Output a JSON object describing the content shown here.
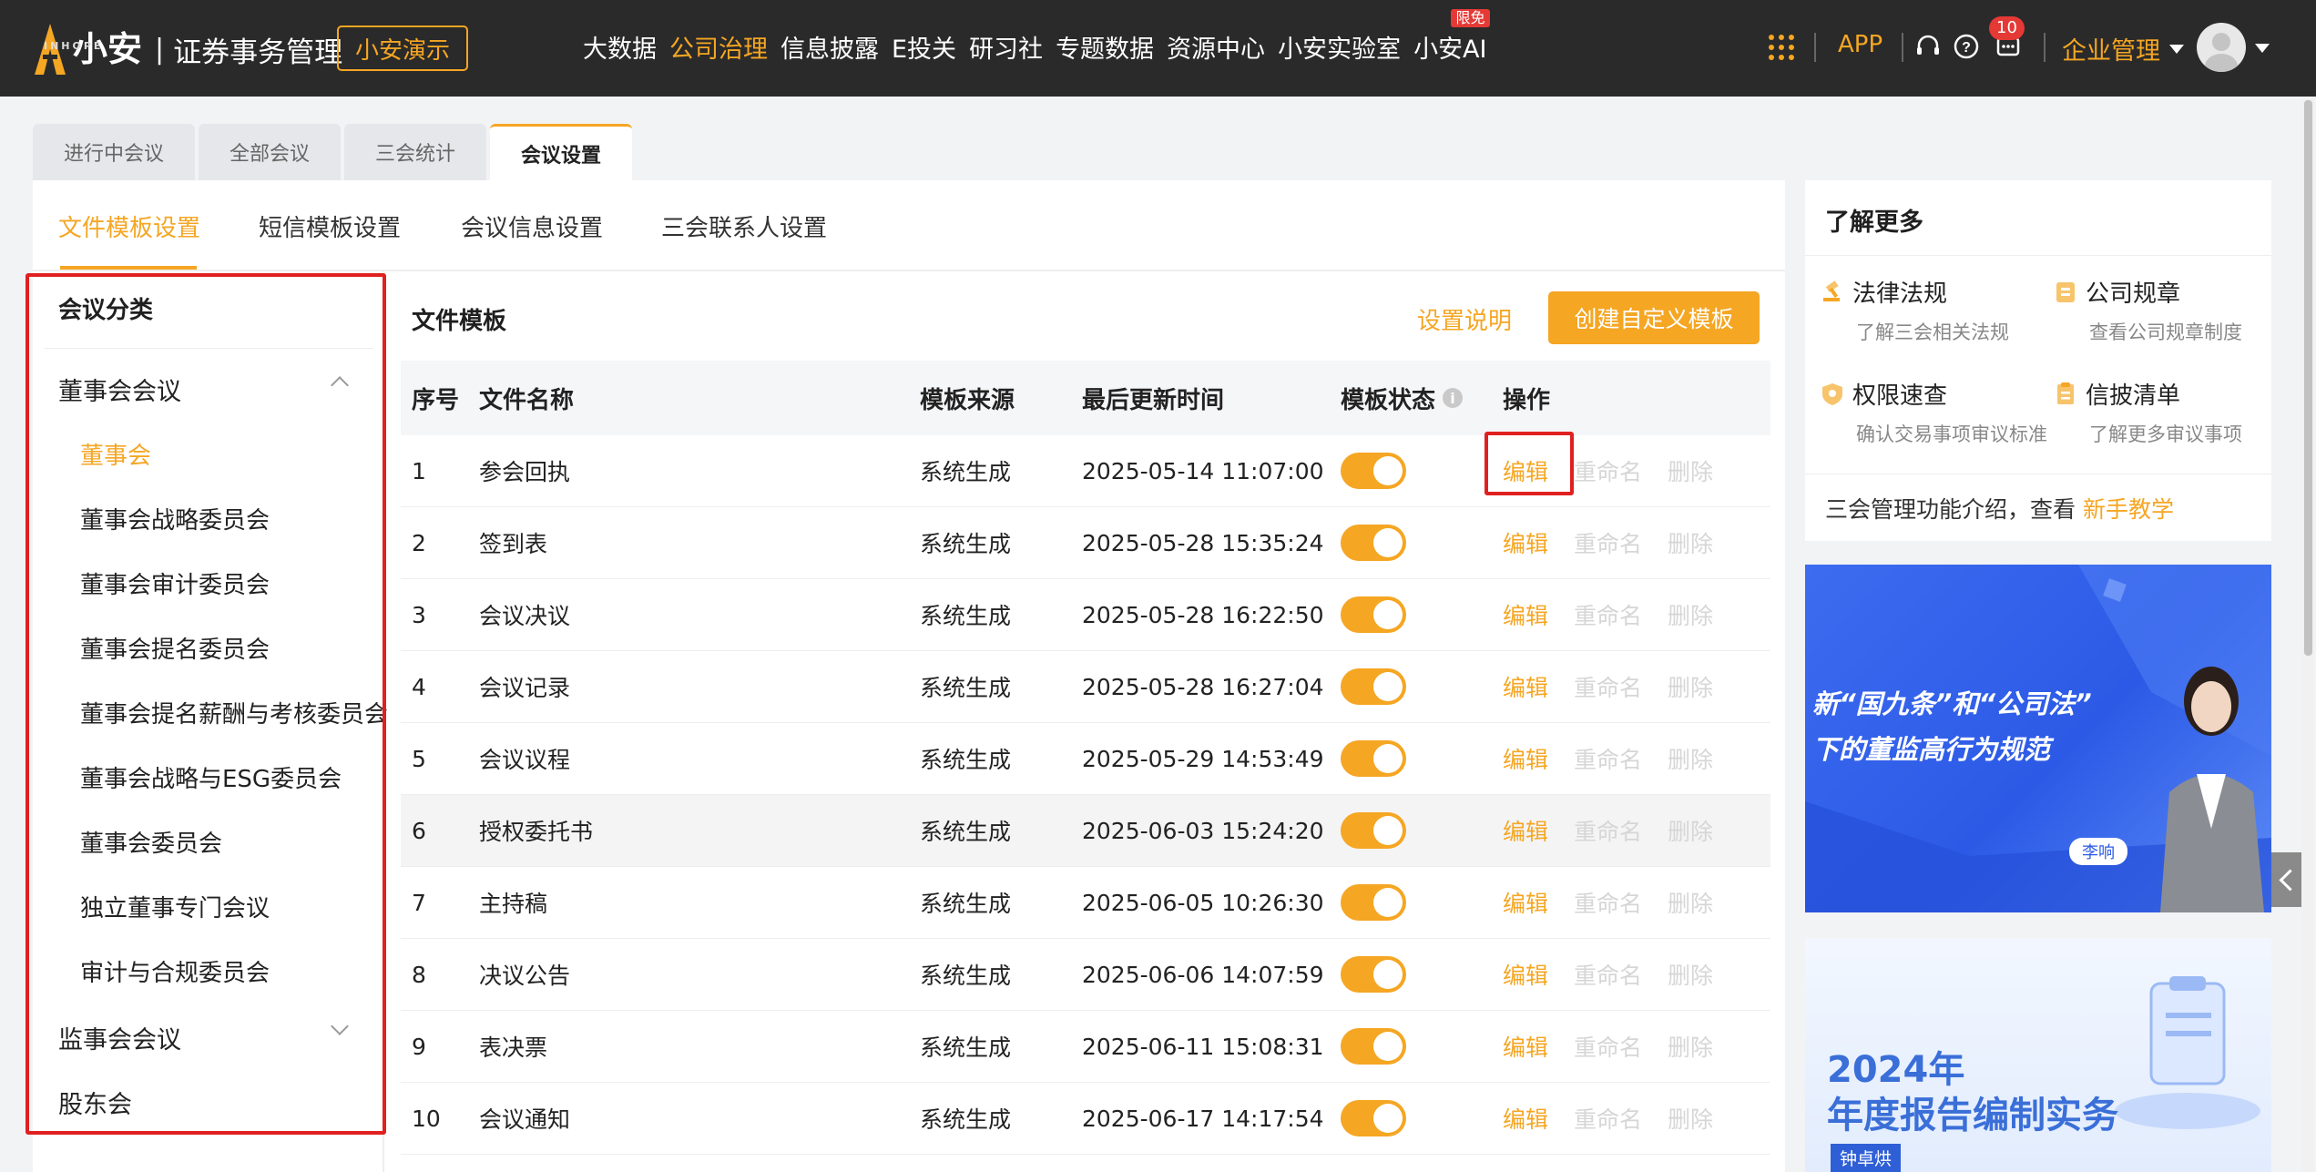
{
  "brand": {
    "name": "小安",
    "sub": "INHOPE",
    "separator": "|",
    "title": "证券事务管理",
    "demo_button": "小安演示"
  },
  "nav": [
    {
      "label": "大数据",
      "active": false
    },
    {
      "label": "公司治理",
      "active": true
    },
    {
      "label": "信息披露",
      "active": false
    },
    {
      "label": "E投关",
      "active": false
    },
    {
      "label": "研习社",
      "active": false
    },
    {
      "label": "专题数据",
      "active": false
    },
    {
      "label": "资源中心",
      "active": false
    },
    {
      "label": "小安实验室",
      "active": false
    },
    {
      "label": "小安AI",
      "active": false,
      "badge": "限免"
    }
  ],
  "topright": {
    "app": "APP",
    "message_count": "10",
    "company_menu": "企业管理",
    "icons": [
      "apps-grid-icon",
      "headset-icon",
      "help-icon",
      "message-icon",
      "avatar"
    ]
  },
  "page_tabs": [
    {
      "label": "进行中会议",
      "active": false
    },
    {
      "label": "全部会议",
      "active": false
    },
    {
      "label": "三会统计",
      "active": false
    },
    {
      "label": "会议设置",
      "active": true
    }
  ],
  "sub_tabs": [
    {
      "label": "文件模板设置",
      "active": true
    },
    {
      "label": "短信模板设置",
      "active": false
    },
    {
      "label": "会议信息设置",
      "active": false
    },
    {
      "label": "三会联系人设置",
      "active": false
    }
  ],
  "categories": {
    "title": "会议分类",
    "groups": [
      {
        "label": "董事会会议",
        "expanded": true,
        "items": [
          {
            "label": "董事会",
            "active": true
          },
          {
            "label": "董事会战略委员会",
            "active": false
          },
          {
            "label": "董事会审计委员会",
            "active": false
          },
          {
            "label": "董事会提名委员会",
            "active": false
          },
          {
            "label": "董事会提名薪酬与考核委员会",
            "active": false
          },
          {
            "label": "董事会战略与ESG委员会",
            "active": false
          },
          {
            "label": "董事会委员会",
            "active": false
          },
          {
            "label": "独立董事专门会议",
            "active": false
          },
          {
            "label": "审计与合规委员会",
            "active": false
          }
        ]
      },
      {
        "label": "监事会会议",
        "expanded": false,
        "items": []
      },
      {
        "label": "股东会",
        "expanded": false,
        "items": []
      }
    ]
  },
  "templates": {
    "title": "文件模板",
    "help_link": "设置说明",
    "create_button": "创建自定义模板",
    "columns": [
      "序号",
      "文件名称",
      "模板来源",
      "最后更新时间",
      "模板状态",
      "操作"
    ],
    "ops": [
      "编辑",
      "重命名",
      "删除"
    ],
    "rows": [
      {
        "idx": "1",
        "name": "参会回执",
        "source": "系统生成",
        "updated": "2025-05-14 11:07:00",
        "enabled": true
      },
      {
        "idx": "2",
        "name": "签到表",
        "source": "系统生成",
        "updated": "2025-05-28 15:35:24",
        "enabled": true
      },
      {
        "idx": "3",
        "name": "会议决议",
        "source": "系统生成",
        "updated": "2025-05-28 16:22:50",
        "enabled": true
      },
      {
        "idx": "4",
        "name": "会议记录",
        "source": "系统生成",
        "updated": "2025-05-28 16:27:04",
        "enabled": true
      },
      {
        "idx": "5",
        "name": "会议议程",
        "source": "系统生成",
        "updated": "2025-05-29 14:53:49",
        "enabled": true
      },
      {
        "idx": "6",
        "name": "授权委托书",
        "source": "系统生成",
        "updated": "2025-06-03 15:24:20",
        "enabled": true
      },
      {
        "idx": "7",
        "name": "主持稿",
        "source": "系统生成",
        "updated": "2025-06-05 10:26:30",
        "enabled": true
      },
      {
        "idx": "8",
        "name": "决议公告",
        "source": "系统生成",
        "updated": "2025-06-06 14:07:59",
        "enabled": true
      },
      {
        "idx": "9",
        "name": "表决票",
        "source": "系统生成",
        "updated": "2025-06-11 15:08:31",
        "enabled": true
      },
      {
        "idx": "10",
        "name": "会议通知",
        "source": "系统生成",
        "updated": "2025-06-17 14:17:54",
        "enabled": true
      }
    ]
  },
  "side": {
    "title": "了解更多",
    "quick": [
      {
        "label": "法律法规",
        "sub": "了解三会相关法规",
        "icon": "gavel-icon"
      },
      {
        "label": "公司规章",
        "sub": "查看公司规章制度",
        "icon": "rules-icon"
      },
      {
        "label": "权限速查",
        "sub": "确认交易事项审议标准",
        "icon": "shield-icon"
      },
      {
        "label": "信披清单",
        "sub": "了解更多审议事项",
        "icon": "checklist-icon"
      }
    ],
    "intro": "三会管理功能介绍，查看",
    "intro_link": "新手教学",
    "banner1": {
      "line1": "新“国九条”和“公司法”",
      "line2": "下的董监高行为规范",
      "name": "李响"
    },
    "banner2": {
      "line1": "2024年",
      "line2": "年度报告编制实务",
      "name": "钟卓烘"
    }
  },
  "colors": {
    "accent": "#f5a623",
    "topbar": "#2a2a2a",
    "highlight": "#e02020"
  }
}
